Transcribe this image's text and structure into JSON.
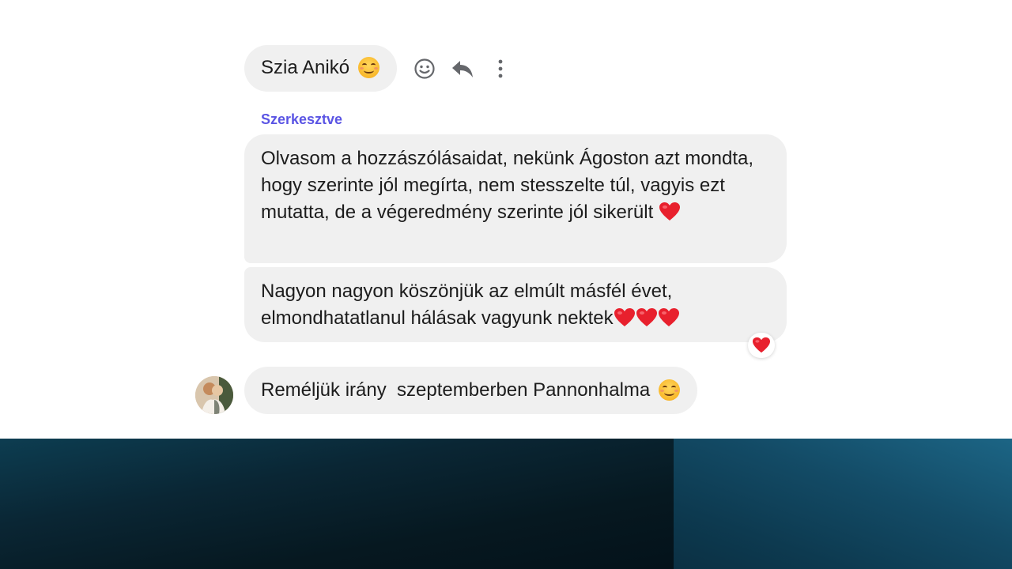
{
  "messages": [
    {
      "text": "Szia Anikó",
      "trailing_emoji": "smiling-face-with-smiling-eyes"
    },
    {
      "text": "Olvasom a hozzászólásaidat, nekünk Ágoston azt mondta, hogy szerinte jól megírta, nem stesszelte túl, vagyis ezt mutatta, de a végeredmény szerinte jól sikerült",
      "trailing_emoji": "red-heart"
    },
    {
      "text": "Nagyon nagyon köszönjük az elmúlt másfél évet, elmondhatatlanul hálásak vagyunk nektek",
      "trailing_emoji": "red-heart-x3"
    },
    {
      "text": "Reméljük irány  szeptemberben Pannonhalma",
      "trailing_emoji": "smiling-face-with-smiling-eyes"
    }
  ],
  "edited_label": "Szerkesztve",
  "reaction": "red-heart",
  "toolbar": {
    "icons": [
      "smiley-react-icon",
      "reply-icon",
      "more-options-icon"
    ]
  },
  "colors": {
    "bubble_bg": "#f0f0f0",
    "edited_label": "#5b55e4",
    "heart": "#e8202d",
    "icon": "#65676b"
  }
}
